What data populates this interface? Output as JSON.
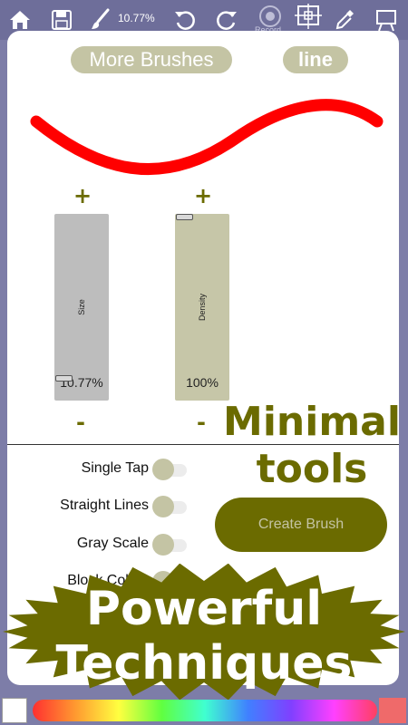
{
  "toolbar": {
    "zoom": "10.77%",
    "record_label": "Record",
    "icons": [
      "home-icon",
      "save-icon",
      "brush-icon",
      "undo-icon",
      "redo-icon",
      "record-icon",
      "grid-icon",
      "eyedropper-icon",
      "canvas-icon"
    ]
  },
  "panel": {
    "more_brushes": "More Brushes",
    "mode": "line",
    "stroke_color": "#ff0000",
    "size_slider": {
      "label": "Size",
      "value": "10.77%",
      "level": 0.1077,
      "plus": "+",
      "minus": "-"
    },
    "density_slider": {
      "label": "Density",
      "value": "100%",
      "level": 1.0,
      "plus": "+",
      "minus": "-"
    },
    "toggles": [
      {
        "label": "Single Tap",
        "on": false
      },
      {
        "label": "Straight Lines",
        "on": false
      },
      {
        "label": "Gray Scale",
        "on": false
      },
      {
        "label": "Block Colors",
        "on": false
      }
    ],
    "create_brush": "Create Brush"
  },
  "promo": {
    "minimal_line1": "Minimal",
    "minimal_line2": "tools",
    "powerful_line1": "Powerful",
    "powerful_line2": "Techniques"
  },
  "colors": {
    "accent": "#6b6b00",
    "pill": "#c4c4a4",
    "toolbar": "#6e6e9a",
    "current_color": "#ef6a6a"
  }
}
